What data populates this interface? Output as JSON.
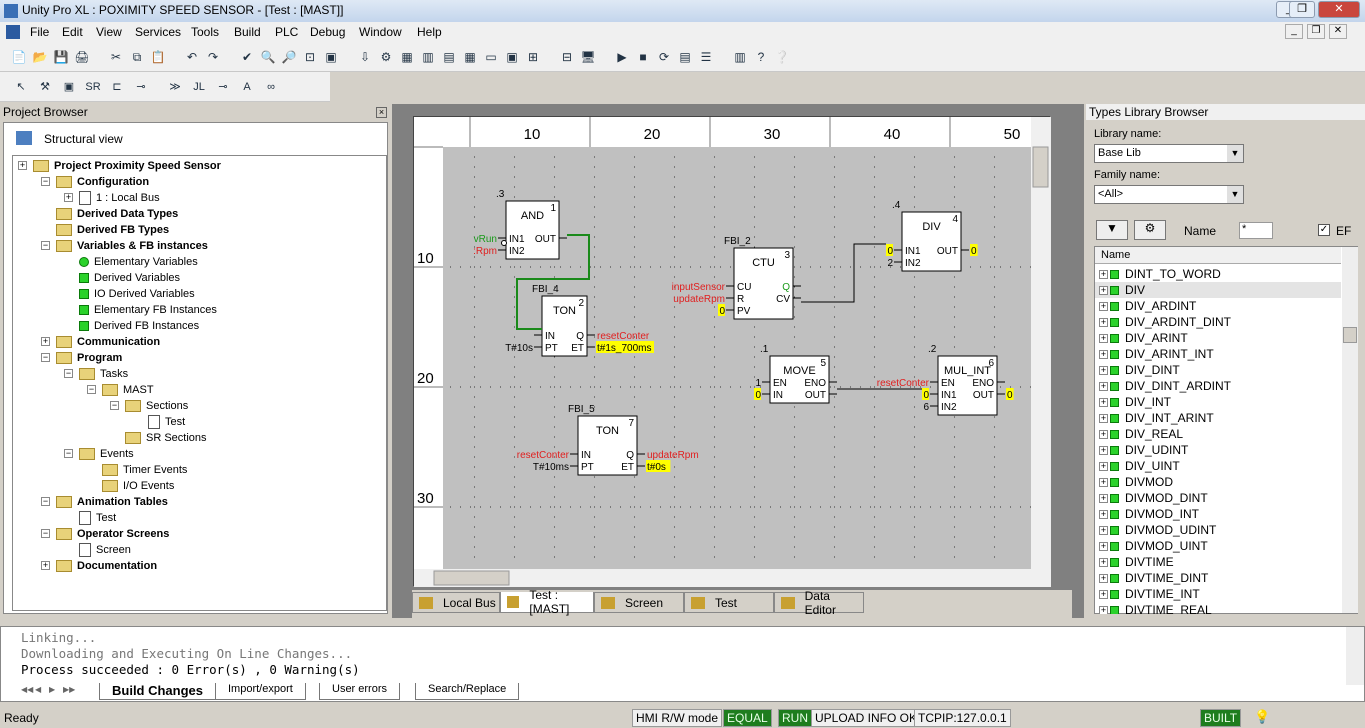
{
  "window": {
    "title": "Unity Pro XL : POXIMITY SPEED SENSOR - [Test : [MAST]]"
  },
  "menu": [
    "File",
    "Edit",
    "View",
    "Services",
    "Tools",
    "Build",
    "PLC",
    "Debug",
    "Window",
    "Help"
  ],
  "project_browser": {
    "title": "Project Browser",
    "view": "Structural view",
    "items": [
      {
        "label": "Project Proximity Speed Sensor",
        "level": 0,
        "icon": "folder",
        "bold": true
      },
      {
        "label": "Configuration",
        "level": 1,
        "icon": "folder",
        "bold": true
      },
      {
        "label": "1 : Local Bus",
        "level": 2,
        "icon": "bus"
      },
      {
        "label": "Derived Data Types",
        "level": 1,
        "icon": "folder",
        "bold": true
      },
      {
        "label": "Derived FB Types",
        "level": 1,
        "icon": "folder",
        "bold": true
      },
      {
        "label": "Variables & FB instances",
        "level": 1,
        "icon": "folder",
        "bold": true
      },
      {
        "label": "Elementary Variables",
        "level": 2,
        "icon": "gdot"
      },
      {
        "label": "Derived Variables",
        "level": 2,
        "icon": "gsq"
      },
      {
        "label": "IO Derived Variables",
        "level": 2,
        "icon": "gsq"
      },
      {
        "label": "Elementary FB Instances",
        "level": 2,
        "icon": "gsq"
      },
      {
        "label": "Derived FB Instances",
        "level": 2,
        "icon": "gsq"
      },
      {
        "label": "Communication",
        "level": 1,
        "icon": "folder",
        "bold": true
      },
      {
        "label": "Program",
        "level": 1,
        "icon": "folder",
        "bold": true
      },
      {
        "label": "Tasks",
        "level": 2,
        "icon": "folder"
      },
      {
        "label": "MAST",
        "level": 3,
        "icon": "folder"
      },
      {
        "label": "Sections",
        "level": 4,
        "icon": "folder"
      },
      {
        "label": "Test",
        "level": 5,
        "icon": "doc"
      },
      {
        "label": "SR Sections",
        "level": 4,
        "icon": "folder"
      },
      {
        "label": "Events",
        "level": 2,
        "icon": "folder"
      },
      {
        "label": "Timer Events",
        "level": 3,
        "icon": "folder"
      },
      {
        "label": "I/O Events",
        "level": 3,
        "icon": "folder"
      },
      {
        "label": "Animation Tables",
        "level": 1,
        "icon": "folder",
        "bold": true
      },
      {
        "label": "Test",
        "level": 2,
        "icon": "doc"
      },
      {
        "label": "Operator Screens",
        "level": 1,
        "icon": "folder",
        "bold": true
      },
      {
        "label": "Screen",
        "level": 2,
        "icon": "doc"
      },
      {
        "label": "Documentation",
        "level": 1,
        "icon": "folder",
        "bold": true
      }
    ]
  },
  "editor": {
    "ruler_top": [
      "10",
      "20",
      "30",
      "40",
      "50"
    ],
    "ruler_left": [
      "10",
      "20",
      "30"
    ],
    "blocks": [
      {
        "id": "and",
        "type": "AND",
        "num": "1",
        "instance": ".3",
        "inputs": [
          [
            "IN1",
            "vRun",
            "green"
          ],
          [
            "IN2",
            ":Rpm",
            "red"
          ]
        ],
        "outputs": [
          [
            "OUT",
            "",
            ""
          ]
        ]
      },
      {
        "id": "ton1",
        "type": "TON",
        "num": "2",
        "instance": "FBI_4",
        "inputs": [
          [
            "IN",
            "",
            ""
          ],
          [
            "PT",
            "T#10s",
            "black"
          ]
        ],
        "outputs": [
          [
            "Q",
            "resetConter",
            "red"
          ],
          [
            "ET",
            "t#1s_700ms",
            "hl"
          ]
        ]
      },
      {
        "id": "ctu",
        "type": "CTU",
        "num": "3",
        "instance": "FBI_2",
        "inputs": [
          [
            "CU",
            "inputSensor",
            "red"
          ],
          [
            "R",
            "updateRpm",
            "red"
          ],
          [
            "PV",
            "0",
            "hl"
          ]
        ],
        "outputs": [
          [
            "Q",
            "",
            ""
          ],
          [
            "CV",
            "",
            ""
          ]
        ]
      },
      {
        "id": "div",
        "type": "DIV",
        "num": "4",
        "instance": ".4",
        "inputs": [
          [
            "IN1",
            "0",
            "hl"
          ],
          [
            "IN2",
            "2",
            "black"
          ]
        ],
        "outputs": [
          [
            "OUT",
            "0",
            "hl"
          ]
        ]
      },
      {
        "id": "move",
        "type": "MOVE",
        "num": "5",
        "instance": ".1",
        "inputs": [
          [
            "EN",
            "1",
            "black"
          ],
          [
            "IN",
            "0",
            "hl"
          ]
        ],
        "outputs": [
          [
            "ENO",
            "",
            ""
          ],
          [
            "OUT",
            "",
            ""
          ]
        ]
      },
      {
        "id": "mul",
        "type": "MUL_INT",
        "num": "6",
        "instance": ".2",
        "inputs": [
          [
            "EN",
            "resetConter",
            "red"
          ],
          [
            "IN1",
            "0",
            "hl"
          ],
          [
            "IN2",
            "6",
            "black"
          ]
        ],
        "outputs": [
          [
            "ENO",
            "",
            ""
          ],
          [
            "OUT",
            "0",
            "hl"
          ]
        ]
      },
      {
        "id": "ton2",
        "type": "TON",
        "num": "7",
        "instance": "FBI_5",
        "inputs": [
          [
            "IN",
            "resetConter",
            "red"
          ],
          [
            "PT",
            "T#10ms",
            "black"
          ]
        ],
        "outputs": [
          [
            "Q",
            "updateRpm",
            "red"
          ],
          [
            "ET",
            "t#0s",
            "hl"
          ]
        ]
      }
    ],
    "tabs": [
      "Local Bus",
      "Test : [MAST]",
      "Screen",
      "Test",
      "Data Editor"
    ]
  },
  "types_library": {
    "title": "Types Library Browser",
    "library_label": "Library name:",
    "library_value": "Base Lib",
    "family_label": "Family name:",
    "family_value": "<All>",
    "name_label": "Name",
    "name_filter": "*",
    "ef_label": "EF",
    "column": "Name",
    "items": [
      "DINT_TO_WORD",
      "DIV",
      "DIV_ARDINT",
      "DIV_ARDINT_DINT",
      "DIV_ARINT",
      "DIV_ARINT_INT",
      "DIV_DINT",
      "DIV_DINT_ARDINT",
      "DIV_INT",
      "DIV_INT_ARINT",
      "DIV_REAL",
      "DIV_UDINT",
      "DIV_UINT",
      "DIVMOD",
      "DIVMOD_DINT",
      "DIVMOD_INT",
      "DIVMOD_UDINT",
      "DIVMOD_UINT",
      "DIVTIME",
      "DIVTIME_DINT",
      "DIVTIME_INT",
      "DIVTIME_REAL"
    ],
    "selected": "DIV"
  },
  "output": {
    "lines": [
      "Linking...",
      "Downloading and Executing On Line Changes...",
      "Process succeeded  : 0 Error(s) , 0 Warning(s)"
    ],
    "tabs": [
      "Build Changes",
      "Import/export",
      "User errors",
      "Search/Replace"
    ]
  },
  "status": {
    "ready": "Ready",
    "hmi": "HMI R/W mode",
    "equal": "EQUAL",
    "run": "RUN",
    "upload": "UPLOAD INFO OK",
    "conn": "TCPIP:127.0.0.1",
    "built": "BUILT"
  },
  "colors": {
    "accent_green": "#1e7d1e",
    "var_red": "#e02020",
    "highlight": "#ffff00",
    "canvas": "#c0c0c0"
  }
}
